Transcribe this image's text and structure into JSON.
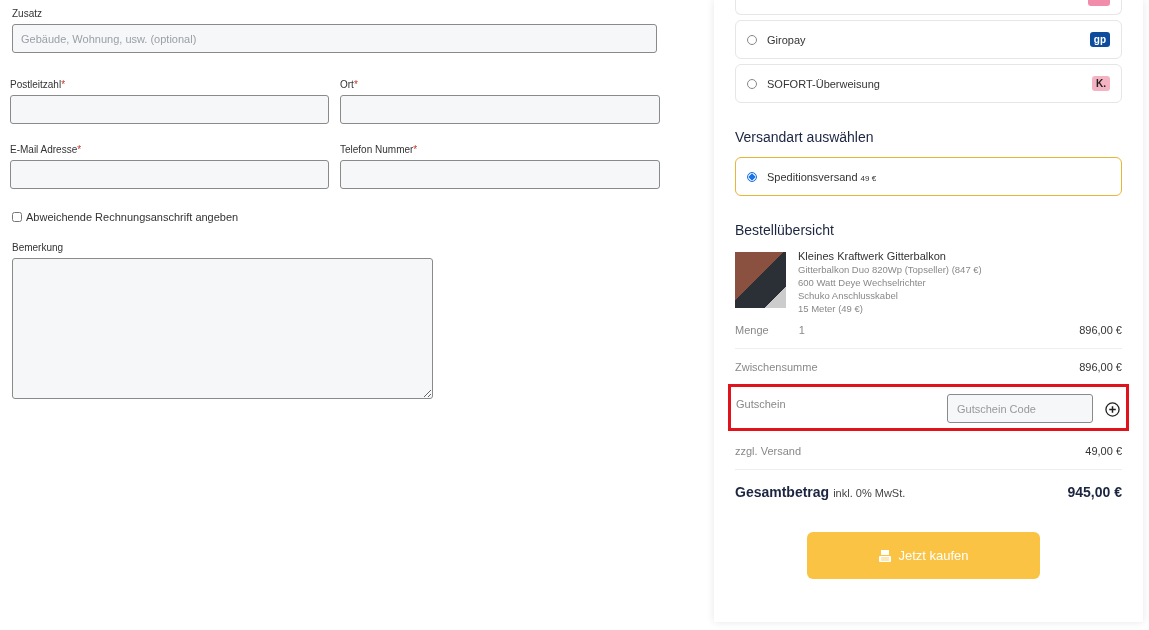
{
  "form": {
    "zusatz": {
      "label": "Zusatz",
      "placeholder": "Gebäude, Wohnung, usw. (optional)"
    },
    "field_rows": [
      [
        {
          "label": "Postleitzahl",
          "required": true
        },
        {
          "label": "Ort",
          "required": true
        }
      ],
      [
        {
          "label": "E-Mail Adresse",
          "required": true
        },
        {
          "label": "Telefon Nummer",
          "required": true
        }
      ]
    ],
    "required_mark": "*",
    "billing_checkbox": {
      "label": "Abweichende Rechnungsanschrift angeben",
      "checked": false
    },
    "remark": {
      "label": "Bemerkung"
    }
  },
  "payment_methods": [
    {
      "label": "Giropay",
      "selected": false,
      "badge": "gp",
      "color": "#0d4c9c"
    },
    {
      "label": "SOFORT-Überweisung",
      "selected": false,
      "badge": "K.",
      "color": "#f4b3c2"
    }
  ],
  "shipping": {
    "title": "Versandart auswählen",
    "options": [
      {
        "label": "Speditionsversand",
        "price": "49 €",
        "selected": true
      }
    ]
  },
  "order": {
    "title": "Bestellübersicht",
    "product": {
      "name": "Kleines Kraftwerk Gitterbalkon",
      "details": [
        "Gitterbalkon Duo 820Wp (Topseller) (847 €)",
        "600 Watt Deye Wechselrichter",
        "Schuko Anschlusskabel",
        "15 Meter (49 €)"
      ]
    },
    "quantity": {
      "label": "Menge",
      "value": "1",
      "price": "896,00 €"
    },
    "subtotal": {
      "label": "Zwischensumme",
      "value": "896,00 €"
    },
    "voucher": {
      "label": "Gutschein",
      "placeholder": "Gutschein Code",
      "highlighted": true
    },
    "shipping_cost": {
      "label": "zzgl. Versand",
      "value": "49,00 €"
    },
    "total": {
      "label": "Gesamtbetrag",
      "note": "inkl. 0% MwSt.",
      "value": "945,00 €"
    },
    "buy_button": "Jetzt kaufen"
  }
}
